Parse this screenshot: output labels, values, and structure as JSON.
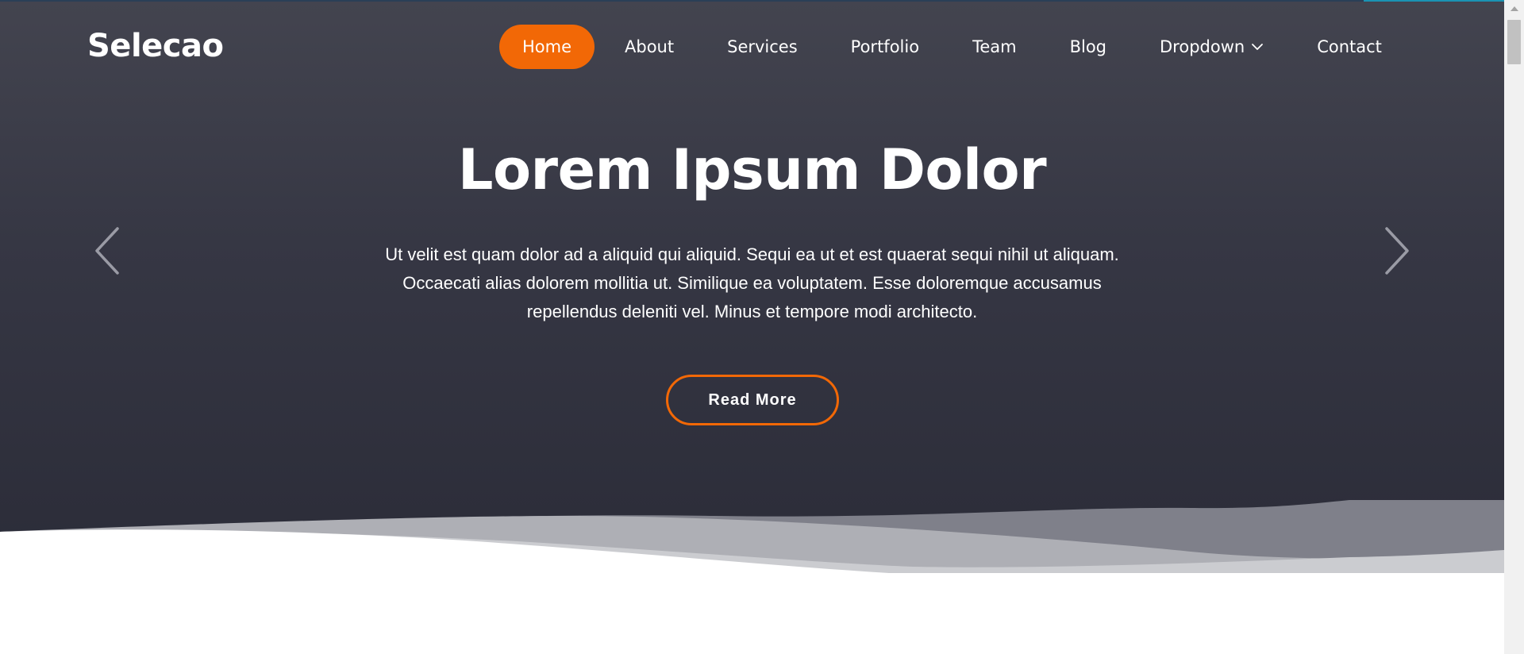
{
  "brand": {
    "name": "Selecao"
  },
  "nav": {
    "items": [
      {
        "label": "Home"
      },
      {
        "label": "About"
      },
      {
        "label": "Services"
      },
      {
        "label": "Portfolio"
      },
      {
        "label": "Team"
      },
      {
        "label": "Blog"
      },
      {
        "label": "Dropdown"
      },
      {
        "label": "Contact"
      }
    ],
    "active_item": "Home"
  },
  "hero": {
    "title": "Lorem Ipsum Dolor",
    "text": "Ut velit est quam dolor ad a aliquid qui aliquid. Sequi ea ut et est quaerat sequi nihil ut aliquam. Occaecati alias dolorem mollitia ut. Similique ea voluptatem. Esse doloremque accusamus repellendus deleniti vel. Minus et tempore modi architecto.",
    "button_label": "Read More"
  },
  "icons": {
    "prev": "chevron-left-icon",
    "next": "chevron-right-icon",
    "dropdown": "chevron-down-icon"
  },
  "colors": {
    "accent": "#f26806",
    "hero_top": "#43444f",
    "hero_bottom": "#2a2b37",
    "text": "#ffffff"
  }
}
